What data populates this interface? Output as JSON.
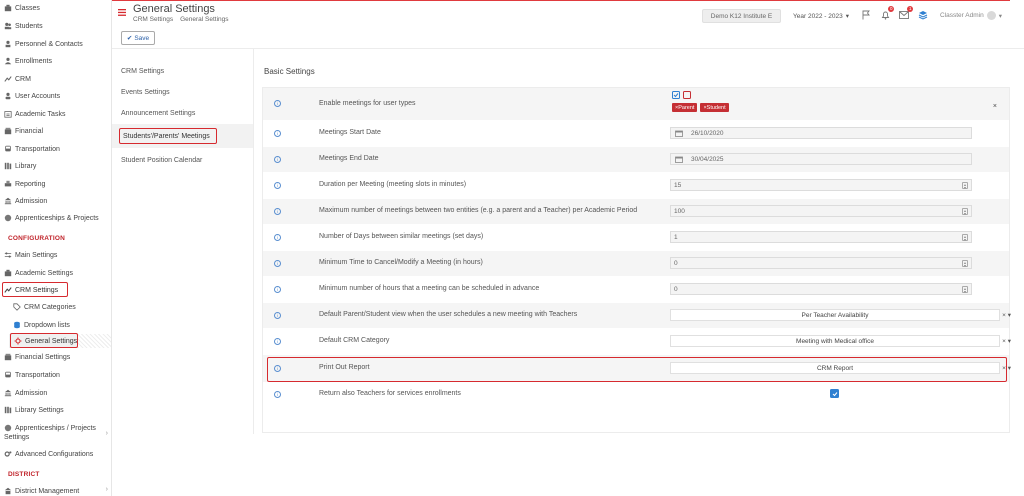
{
  "sidebar": {
    "items": [
      {
        "label": "Classes",
        "icon": "classes-icon"
      },
      {
        "label": "Students",
        "icon": "students-icon"
      },
      {
        "label": "Personnel & Contacts",
        "icon": "personnel-icon"
      },
      {
        "label": "Enrollments",
        "icon": "enrollments-icon"
      },
      {
        "label": "CRM",
        "icon": "crm-icon"
      },
      {
        "label": "User Accounts",
        "icon": "user-accounts-icon"
      },
      {
        "label": "Academic Tasks",
        "icon": "academic-tasks-icon"
      },
      {
        "label": "Financial",
        "icon": "financial-icon"
      },
      {
        "label": "Transportation",
        "icon": "transportation-icon"
      },
      {
        "label": "Library",
        "icon": "library-icon"
      },
      {
        "label": "Reporting",
        "icon": "reporting-icon"
      },
      {
        "label": "Admission",
        "icon": "admission-icon"
      },
      {
        "label": "Apprenticeships & Projects",
        "icon": "apprenticeships-icon"
      }
    ],
    "config_header": "CONFIGURATION",
    "config_items": [
      {
        "label": "Main Settings",
        "icon": "main-settings-icon"
      },
      {
        "label": "Academic Settings",
        "icon": "academic-settings-icon"
      },
      {
        "label": "CRM Settings",
        "icon": "crm-settings-icon"
      },
      {
        "label": "CRM Categories",
        "icon": "crm-categories-icon"
      },
      {
        "label": "Dropdown lists",
        "icon": "dropdown-lists-icon"
      },
      {
        "label": "General Settings",
        "icon": "general-settings-icon"
      },
      {
        "label": "Financial Settings",
        "icon": "financial-settings-icon"
      },
      {
        "label": "Transportation",
        "icon": "transportation-icon"
      },
      {
        "label": "Admission",
        "icon": "admission-icon"
      },
      {
        "label": "Library Settings",
        "icon": "library-settings-icon"
      },
      {
        "label": "Apprenticeships / Projects",
        "label2": "Settings",
        "icon": "apprenticeships-icon"
      },
      {
        "label": "Advanced Configurations",
        "icon": "advanced-config-icon"
      }
    ],
    "district_header": "DISTRICT",
    "district_items": [
      {
        "label": "District Management",
        "icon": "district-icon"
      }
    ]
  },
  "header": {
    "title": "General Settings",
    "breadcrumb": [
      "CRM Settings",
      "General Settings"
    ],
    "org": "Demo K12 Institute E",
    "year": "Year 2022 - 2023",
    "notif_count": "0",
    "mail_count": "1",
    "user": "Classter Admin"
  },
  "toolbar": {
    "save_label": "Save"
  },
  "settings_nav": {
    "items": [
      "CRM Settings",
      "Events Settings",
      "Announcement Settings",
      "Students'/Parents' Meetings",
      "Student Position Calendar"
    ]
  },
  "main": {
    "section_title": "Basic Settings",
    "rows": [
      {
        "label": "Enable meetings for user types",
        "tags": [
          "Parent",
          "Student"
        ]
      },
      {
        "label": "Meetings Start Date",
        "value": "26/10/2020"
      },
      {
        "label": "Meetings End Date",
        "value": "30/04/2025"
      },
      {
        "label": "Duration per Meeting (meeting slots in minutes)",
        "value": "15"
      },
      {
        "label": "Maximum number of meetings between two entities (e.g. a parent and a Teacher) per Academic Period",
        "value": "100"
      },
      {
        "label": "Number of Days between similar meetings (set days)",
        "value": "1"
      },
      {
        "label": "Minimum Time to Cancel/Modify a Meeting (in hours)",
        "value": "0"
      },
      {
        "label": "Minimum number of hours that a meeting can be scheduled in advance",
        "value": "0"
      },
      {
        "label": "Default Parent/Student view when the user schedules a new meeting with Teachers",
        "value": "Per Teacher Availability"
      },
      {
        "label": "Default CRM Category",
        "value": "Meeting with Medical office"
      },
      {
        "label": "Print Out Report",
        "value": "CRM Report"
      },
      {
        "label": "Return also Teachers for services enrollments",
        "checked": true
      }
    ]
  },
  "colors": {
    "accent_red": "#d62a2f",
    "tag_red": "#c52f34",
    "blue": "#2f80d1"
  }
}
